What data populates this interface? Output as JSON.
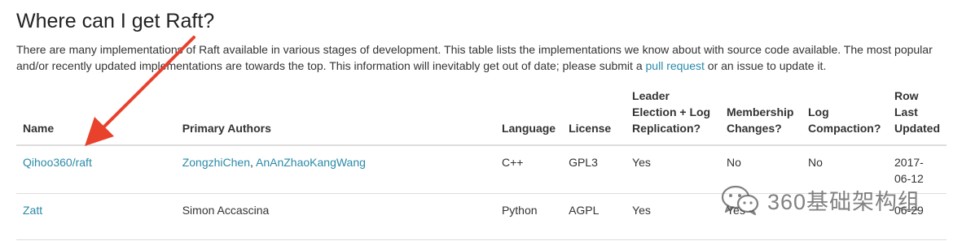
{
  "heading": "Where can I get Raft?",
  "intro": {
    "text_before_link": "There are many implementations of Raft available in various stages of development. This table lists the implementations we know about with source code available. The most popular and/or recently updated implementations are towards the top. This information will inevitably get out of date; please submit a ",
    "link_text": "pull request",
    "text_after_link": " or an issue to update it."
  },
  "table": {
    "headers": {
      "name": "Name",
      "authors": "Primary Authors",
      "language": "Language",
      "license": "License",
      "leader": "Leader Election + Log Replication?",
      "membership": "Membership Changes?",
      "compaction": "Log Compaction?",
      "updated": "Row Last Updated"
    },
    "rows": [
      {
        "name": "Qihoo360/raft",
        "author1": "ZongzhiChen",
        "author_sep": ", ",
        "author2": "AnAnZhaoKangWang",
        "language": "C++",
        "license": "GPL3",
        "leader": "Yes",
        "membership": "No",
        "compaction": "No",
        "updated": "2017-06-12"
      },
      {
        "name": "Zatt",
        "author1": "Simon Accascina",
        "language": "Python",
        "license": "AGPL",
        "leader": "Yes",
        "membership": "Yes",
        "compaction": "",
        "updated": "06-29"
      }
    ]
  },
  "watermark": {
    "text": "360基础架构组",
    "icon": "wechat-icon"
  },
  "colors": {
    "link": "#2a8aa8",
    "arrow": "#e8412c",
    "border": "#dddddd"
  }
}
